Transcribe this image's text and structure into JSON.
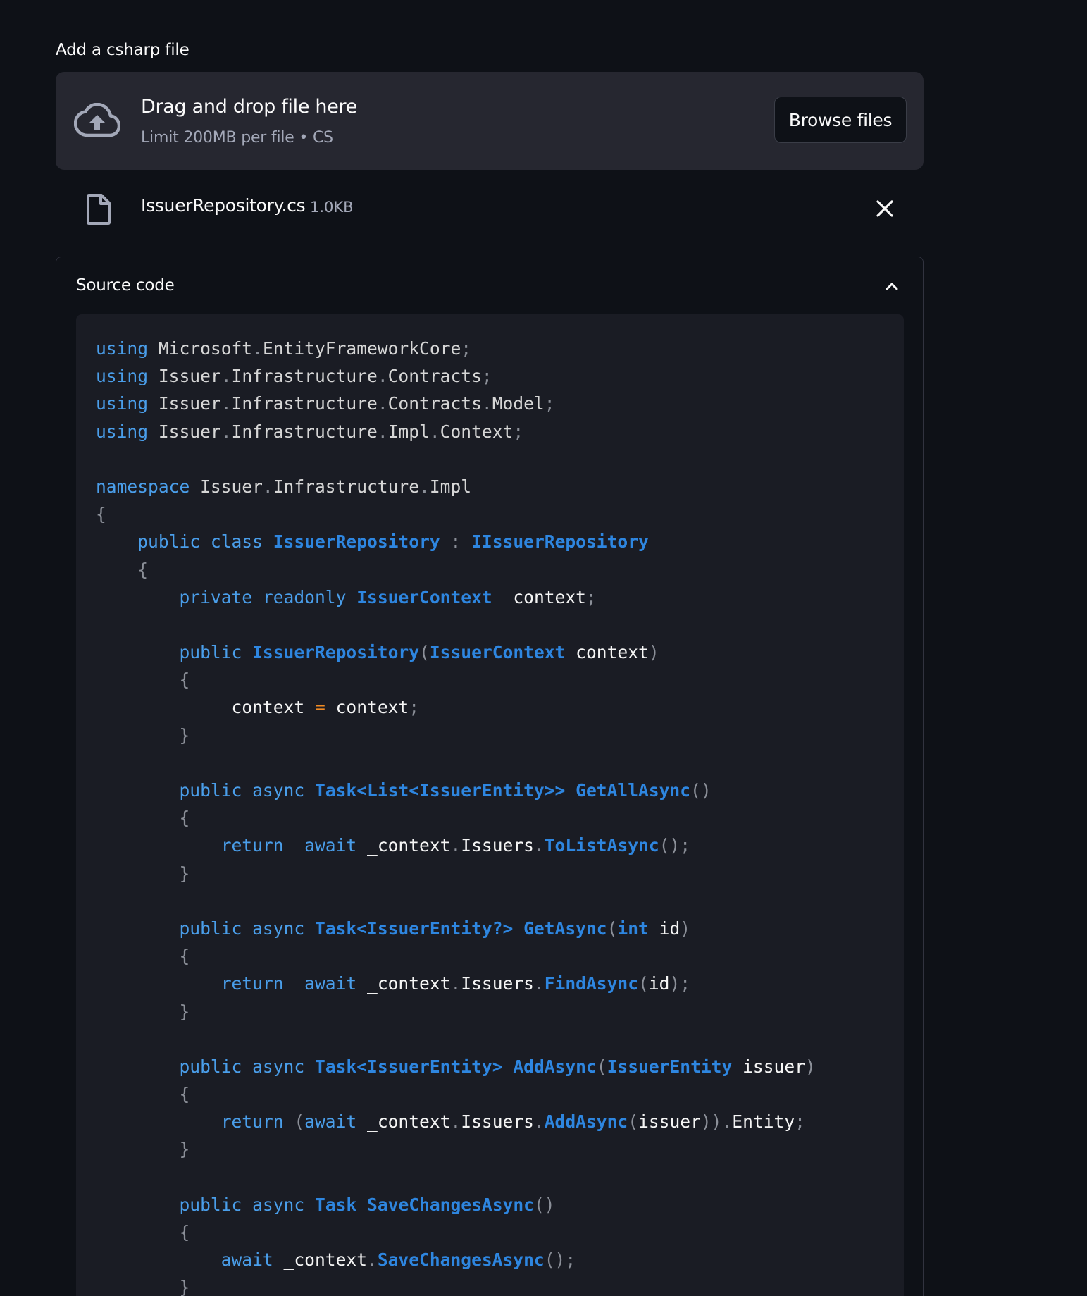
{
  "uploader": {
    "label": "Add a csharp file",
    "drop_title": "Drag and drop file here",
    "limit_text": "Limit 200MB per file • CS",
    "browse_label": "Browse files",
    "upload_icon": "cloud-upload-icon"
  },
  "uploaded_file": {
    "name": "IssuerRepository.cs",
    "size": "1.0KB",
    "file_icon": "file-icon",
    "remove_icon": "close-icon"
  },
  "expander": {
    "title": "Source code",
    "expanded": true,
    "toggle_icon": "chevron-up-icon"
  },
  "colors": {
    "background": "#0e1117",
    "surface": "#262730",
    "code_background": "#1a1c24",
    "keyword": "#4a9eea",
    "type": "#2e86e0",
    "operator": "#f08a24"
  },
  "code": {
    "language": "csharp",
    "lines": [
      [
        [
          "kw",
          "using"
        ],
        [
          "tx",
          " Microsoft"
        ],
        [
          "pn",
          "."
        ],
        [
          "tx",
          "EntityFrameworkCore"
        ],
        [
          "pn",
          ";"
        ]
      ],
      [
        [
          "kw",
          "using"
        ],
        [
          "tx",
          " Issuer"
        ],
        [
          "pn",
          "."
        ],
        [
          "tx",
          "Infrastructure"
        ],
        [
          "pn",
          "."
        ],
        [
          "tx",
          "Contracts"
        ],
        [
          "pn",
          ";"
        ]
      ],
      [
        [
          "kw",
          "using"
        ],
        [
          "tx",
          " Issuer"
        ],
        [
          "pn",
          "."
        ],
        [
          "tx",
          "Infrastructure"
        ],
        [
          "pn",
          "."
        ],
        [
          "tx",
          "Contracts"
        ],
        [
          "pn",
          "."
        ],
        [
          "tx",
          "Model"
        ],
        [
          "pn",
          ";"
        ]
      ],
      [
        [
          "kw",
          "using"
        ],
        [
          "tx",
          " Issuer"
        ],
        [
          "pn",
          "."
        ],
        [
          "tx",
          "Infrastructure"
        ],
        [
          "pn",
          "."
        ],
        [
          "tx",
          "Impl"
        ],
        [
          "pn",
          "."
        ],
        [
          "tx",
          "Context"
        ],
        [
          "pn",
          ";"
        ]
      ],
      [],
      [
        [
          "kw",
          "namespace"
        ],
        [
          "tx",
          " Issuer"
        ],
        [
          "pn",
          "."
        ],
        [
          "tx",
          "Infrastructure"
        ],
        [
          "pn",
          "."
        ],
        [
          "tx",
          "Impl"
        ]
      ],
      [
        [
          "pn",
          "{"
        ]
      ],
      [
        [
          "tx",
          "    "
        ],
        [
          "kw",
          "public"
        ],
        [
          "tx",
          " "
        ],
        [
          "kw",
          "class"
        ],
        [
          "tx",
          " "
        ],
        [
          "ty",
          "IssuerRepository"
        ],
        [
          "tx",
          " "
        ],
        [
          "pn",
          ":"
        ],
        [
          "tx",
          " "
        ],
        [
          "ty",
          "IIssuerRepository"
        ]
      ],
      [
        [
          "tx",
          "    "
        ],
        [
          "pn",
          "{"
        ]
      ],
      [
        [
          "tx",
          "        "
        ],
        [
          "kw",
          "private"
        ],
        [
          "tx",
          " "
        ],
        [
          "kw",
          "readonly"
        ],
        [
          "tx",
          " "
        ],
        [
          "ty",
          "IssuerContext"
        ],
        [
          "wt",
          " _context"
        ],
        [
          "pn",
          ";"
        ]
      ],
      [],
      [
        [
          "tx",
          "        "
        ],
        [
          "kw",
          "public"
        ],
        [
          "tx",
          " "
        ],
        [
          "fn",
          "IssuerRepository"
        ],
        [
          "pn",
          "("
        ],
        [
          "ty",
          "IssuerContext"
        ],
        [
          "wt",
          " context"
        ],
        [
          "pn",
          ")"
        ]
      ],
      [
        [
          "tx",
          "        "
        ],
        [
          "pn",
          "{"
        ]
      ],
      [
        [
          "tx",
          "            "
        ],
        [
          "wt",
          "_context"
        ],
        [
          "tx",
          " "
        ],
        [
          "op",
          "="
        ],
        [
          "wt",
          " context"
        ],
        [
          "pn",
          ";"
        ]
      ],
      [
        [
          "tx",
          "        "
        ],
        [
          "pn",
          "}"
        ]
      ],
      [],
      [
        [
          "tx",
          "        "
        ],
        [
          "kw",
          "public"
        ],
        [
          "tx",
          " "
        ],
        [
          "kw",
          "async"
        ],
        [
          "tx",
          " "
        ],
        [
          "ty",
          "Task<List<IssuerEntity>>"
        ],
        [
          "tx",
          " "
        ],
        [
          "fn",
          "GetAllAsync"
        ],
        [
          "pn",
          "()"
        ]
      ],
      [
        [
          "tx",
          "        "
        ],
        [
          "pn",
          "{"
        ]
      ],
      [
        [
          "tx",
          "            "
        ],
        [
          "kw",
          "return"
        ],
        [
          "tx",
          "  "
        ],
        [
          "kw",
          "await"
        ],
        [
          "wt",
          " _context"
        ],
        [
          "pn",
          "."
        ],
        [
          "wt",
          "Issuers"
        ],
        [
          "pn",
          "."
        ],
        [
          "fn",
          "ToListAsync"
        ],
        [
          "pn",
          "();"
        ]
      ],
      [
        [
          "tx",
          "        "
        ],
        [
          "pn",
          "}"
        ]
      ],
      [],
      [
        [
          "tx",
          "        "
        ],
        [
          "kw",
          "public"
        ],
        [
          "tx",
          " "
        ],
        [
          "kw",
          "async"
        ],
        [
          "tx",
          " "
        ],
        [
          "ty",
          "Task<IssuerEntity?>"
        ],
        [
          "tx",
          " "
        ],
        [
          "fn",
          "GetAsync"
        ],
        [
          "pn",
          "("
        ],
        [
          "ty",
          "int"
        ],
        [
          "wt",
          " id"
        ],
        [
          "pn",
          ")"
        ]
      ],
      [
        [
          "tx",
          "        "
        ],
        [
          "pn",
          "{"
        ]
      ],
      [
        [
          "tx",
          "            "
        ],
        [
          "kw",
          "return"
        ],
        [
          "tx",
          "  "
        ],
        [
          "kw",
          "await"
        ],
        [
          "wt",
          " _context"
        ],
        [
          "pn",
          "."
        ],
        [
          "wt",
          "Issuers"
        ],
        [
          "pn",
          "."
        ],
        [
          "fn",
          "FindAsync"
        ],
        [
          "pn",
          "("
        ],
        [
          "wt",
          "id"
        ],
        [
          "pn",
          ");"
        ]
      ],
      [
        [
          "tx",
          "        "
        ],
        [
          "pn",
          "}"
        ]
      ],
      [],
      [
        [
          "tx",
          "        "
        ],
        [
          "kw",
          "public"
        ],
        [
          "tx",
          " "
        ],
        [
          "kw",
          "async"
        ],
        [
          "tx",
          " "
        ],
        [
          "ty",
          "Task<IssuerEntity>"
        ],
        [
          "tx",
          " "
        ],
        [
          "fn",
          "AddAsync"
        ],
        [
          "pn",
          "("
        ],
        [
          "ty",
          "IssuerEntity"
        ],
        [
          "wt",
          " issuer"
        ],
        [
          "pn",
          ")"
        ]
      ],
      [
        [
          "tx",
          "        "
        ],
        [
          "pn",
          "{"
        ]
      ],
      [
        [
          "tx",
          "            "
        ],
        [
          "kw",
          "return"
        ],
        [
          "tx",
          " "
        ],
        [
          "pn",
          "("
        ],
        [
          "kw",
          "await"
        ],
        [
          "wt",
          " _context"
        ],
        [
          "pn",
          "."
        ],
        [
          "wt",
          "Issuers"
        ],
        [
          "pn",
          "."
        ],
        [
          "fn",
          "AddAsync"
        ],
        [
          "pn",
          "("
        ],
        [
          "wt",
          "issuer"
        ],
        [
          "pn",
          "))."
        ],
        [
          "wt",
          "Entity"
        ],
        [
          "pn",
          ";"
        ]
      ],
      [
        [
          "tx",
          "        "
        ],
        [
          "pn",
          "}"
        ]
      ],
      [],
      [
        [
          "tx",
          "        "
        ],
        [
          "kw",
          "public"
        ],
        [
          "tx",
          " "
        ],
        [
          "kw",
          "async"
        ],
        [
          "tx",
          " "
        ],
        [
          "ty",
          "Task"
        ],
        [
          "tx",
          " "
        ],
        [
          "fn",
          "SaveChangesAsync"
        ],
        [
          "pn",
          "()"
        ]
      ],
      [
        [
          "tx",
          "        "
        ],
        [
          "pn",
          "{"
        ]
      ],
      [
        [
          "tx",
          "            "
        ],
        [
          "kw",
          "await"
        ],
        [
          "wt",
          " _context"
        ],
        [
          "pn",
          "."
        ],
        [
          "fn",
          "SaveChangesAsync"
        ],
        [
          "pn",
          "();"
        ]
      ],
      [
        [
          "tx",
          "        "
        ],
        [
          "pn",
          "}"
        ]
      ]
    ]
  }
}
